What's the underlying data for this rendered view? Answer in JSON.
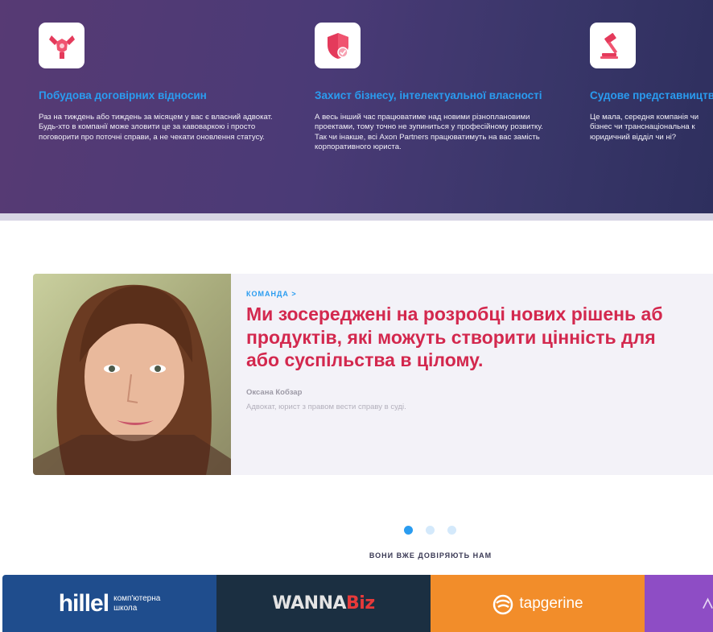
{
  "services": [
    {
      "icon": "handshake-icon",
      "title": "Побудова договірних відносин",
      "text": "Раз на тиждень або тиждень за місяцем у вас є власний адвокат. Будь-хто в компанії може зловити це за кавоваркою і просто поговорити про поточні справи, а не чекати оновлення статусу."
    },
    {
      "icon": "shield-check-icon",
      "title": "Захист бізнесу, інтелектуальної власності",
      "text": "А весь інший час працюватиме над новими різноплановими проектами, тому точно не зупиниться у професійному розвитку. Так чи інакше, всі Axon Partners працюватимуть на вас замість корпоративного юриста."
    },
    {
      "icon": "gavel-icon",
      "title": "Судове представництво",
      "text": "Це мала, середня компанія чи бізнес чи транснаціональна к юридичний відділ чи ні?"
    }
  ],
  "testimonial": {
    "eyebrow": "КОМАНДА >",
    "quote_lines": [
      "Ми зосереджені на розробці нових рішень аб",
      "продуктів, які можуть створити цінність для",
      "або суспільства в цілому."
    ],
    "author": "Оксана Кобзар",
    "role": "Адвокат, юрист з правом вести справу в суді."
  },
  "carousel": {
    "count": 3,
    "active": 1
  },
  "trust_heading": "ВОНИ ВЖЕ ДОВІРЯЮТЬ НАМ",
  "clients": [
    {
      "name": "hillel",
      "sub": [
        "комп'ютерна",
        "школа"
      ],
      "color": "#1f4d8d"
    },
    {
      "name_a": "WANNA",
      "name_b": "Biz",
      "color": "#1b2f41"
    },
    {
      "name": "tapgerine",
      "color": "#f28d2a"
    },
    {
      "name": "",
      "color": "#8e4dc5"
    }
  ],
  "colors": {
    "accent_blue": "#2a9cf0",
    "quote_red": "#d3284e"
  }
}
